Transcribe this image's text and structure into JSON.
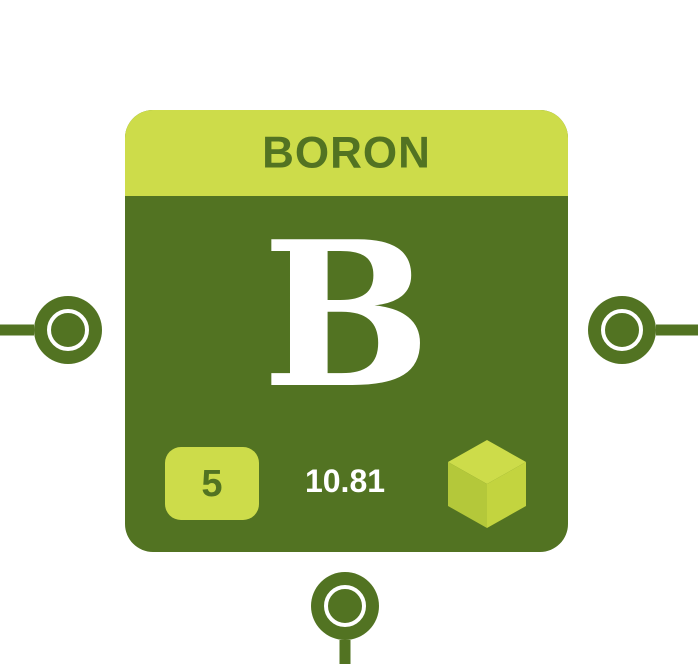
{
  "element": {
    "name": "BORON",
    "symbol": "B",
    "atomic_number": "5",
    "atomic_mass": "10.81"
  },
  "icons": {
    "solid_state": "cube-icon",
    "connector": "connector-node-icon"
  },
  "colors": {
    "dark_green": "#527322",
    "lime": "#cddc4a",
    "white": "#ffffff"
  }
}
